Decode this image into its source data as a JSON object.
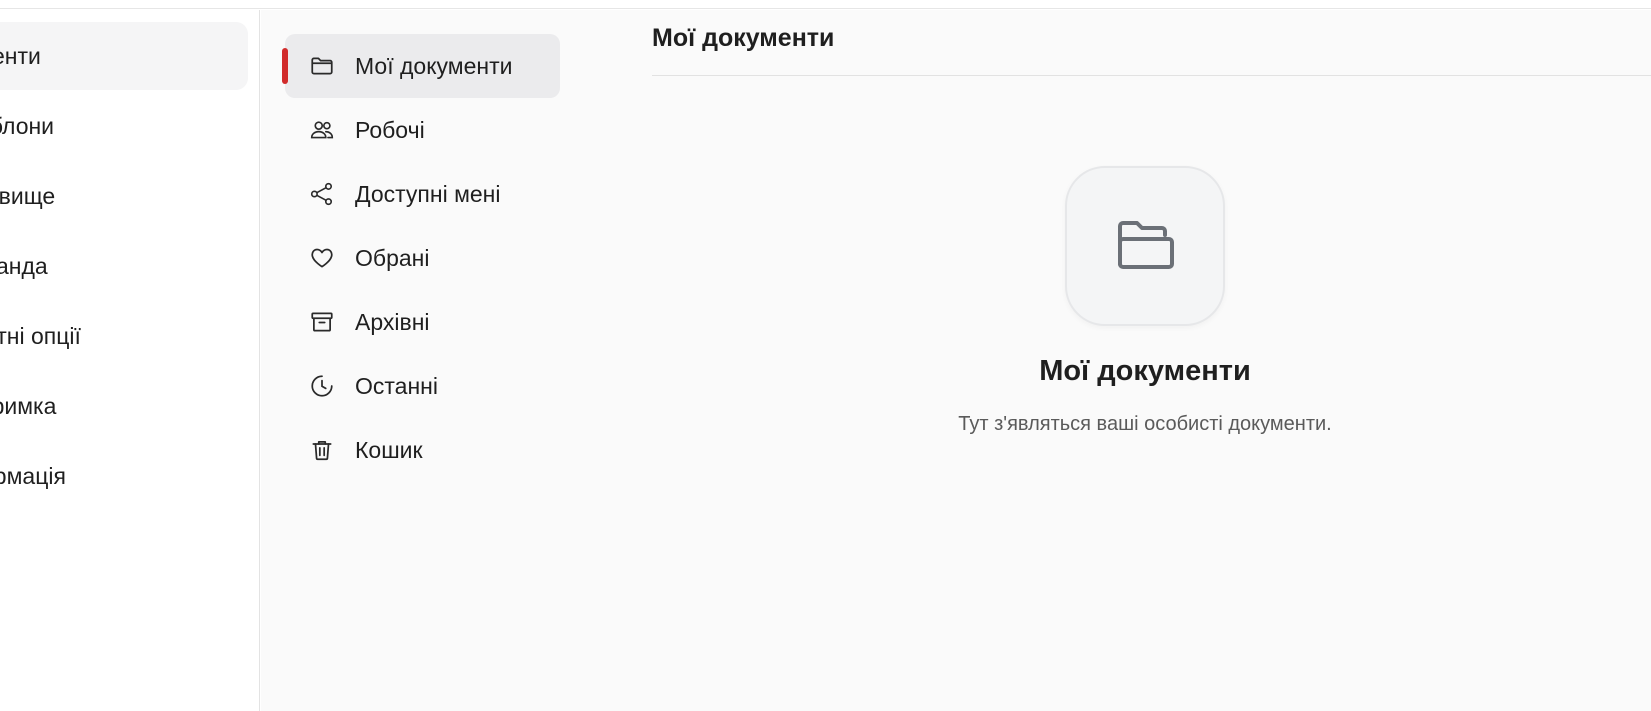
{
  "main_nav": {
    "items": [
      {
        "label": "Документи",
        "active": true
      },
      {
        "label": "Шаблони",
        "active": false
      },
      {
        "label": "Сховище",
        "active": false
      },
      {
        "label": "Команда",
        "active": false
      },
      {
        "label": "Платні опції",
        "active": false
      },
      {
        "label": "Підтримка",
        "active": false
      },
      {
        "label": "Інформація",
        "active": false
      }
    ]
  },
  "sub_nav": {
    "items": [
      {
        "label": "Мої документи",
        "icon": "folder-icon",
        "active": true
      },
      {
        "label": "Робочі",
        "icon": "users-icon",
        "active": false
      },
      {
        "label": "Доступні мені",
        "icon": "share-icon",
        "active": false
      },
      {
        "label": "Обрані",
        "icon": "heart-icon",
        "active": false
      },
      {
        "label": "Архівні",
        "icon": "archive-icon",
        "active": false
      },
      {
        "label": "Останні",
        "icon": "clock-icon",
        "active": false
      },
      {
        "label": "Кошик",
        "icon": "trash-icon",
        "active": false
      }
    ]
  },
  "main": {
    "title": "Мої документи",
    "empty_state": {
      "icon": "folder-open-icon",
      "title": "Мої документи",
      "text": "Тут з'являться ваші особисті документи."
    }
  },
  "colors": {
    "accent": "#d12b2b",
    "active_bg": "#ebebed",
    "content_bg": "#fafafa"
  }
}
